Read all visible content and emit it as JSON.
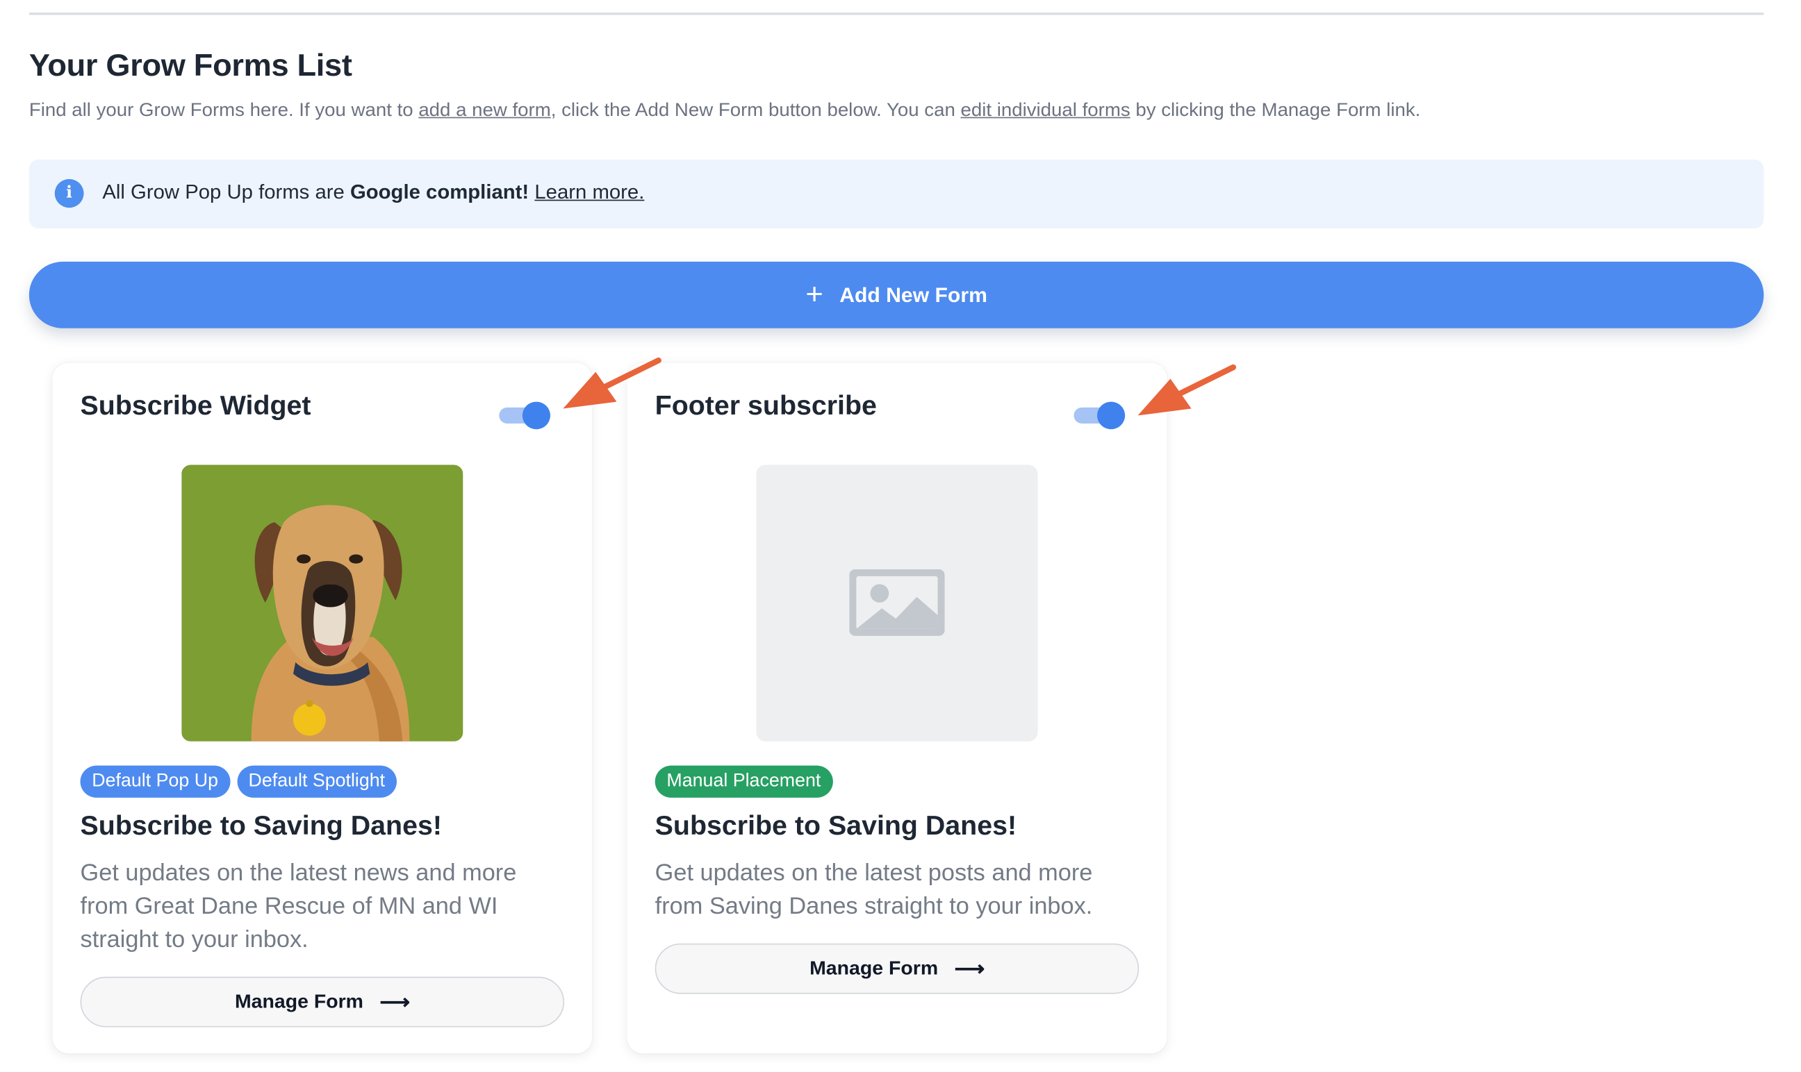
{
  "page": {
    "title": "Your Grow Forms List",
    "intro_before": "Find all your Grow Forms here. If you want to ",
    "intro_link1": "add a new form",
    "intro_middle": ", click the Add New Form button below. You can ",
    "intro_link2": "edit individual forms",
    "intro_after": " by clicking the Manage Form link."
  },
  "notice": {
    "icon": "info-icon",
    "icon_glyph": "i",
    "text_before": "All Grow Pop Up forms are ",
    "text_bold": "Google compliant!",
    "link": "Learn more."
  },
  "add_button": {
    "icon": "plus-icon",
    "icon_glyph": "+",
    "label": "Add New Form",
    "color": "#4e8bf0"
  },
  "forms": [
    {
      "name": "Subscribe Widget",
      "enabled": true,
      "thumbnail": "great-dane-photo",
      "tags": [
        "Default Pop Up",
        "Default Spotlight"
      ],
      "heading": "Subscribe to Saving Danes!",
      "description": "Get updates on the latest news and more from Great Dane Rescue of MN and WI straight to your inbox.",
      "manage_label": "Manage Form",
      "manage_icon": "arrow-right-icon",
      "manage_glyph": "⟶"
    },
    {
      "name": "Footer subscribe",
      "enabled": true,
      "thumbnail": "image-placeholder-icon",
      "tags": [
        "Manual Placement"
      ],
      "heading": "Subscribe to Saving Danes!",
      "description": "Get updates on the latest posts and more from Saving Danes straight to your inbox.",
      "manage_label": "Manage Form",
      "manage_icon": "arrow-right-icon",
      "manage_glyph": "⟶"
    }
  ],
  "colors": {
    "accent": "#4e8bf0",
    "toggle_on": "#3f82ee",
    "tag_green": "#27a063",
    "callout_arrow": "#e8643a",
    "notice_bg": "#eef4fd"
  }
}
